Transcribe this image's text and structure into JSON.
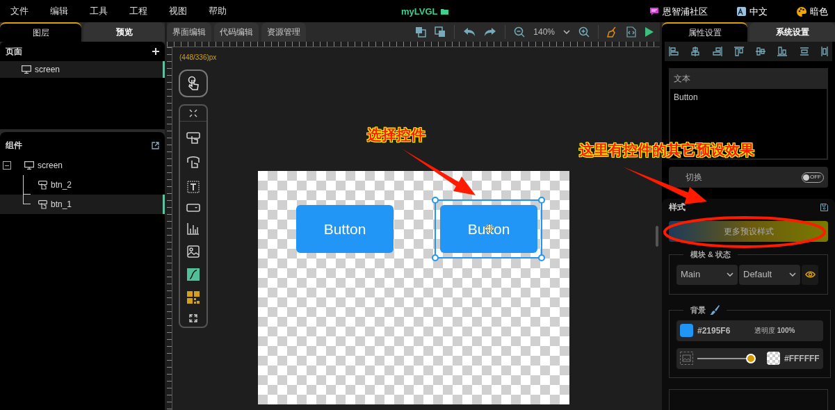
{
  "menu": [
    "文件",
    "编辑",
    "工具",
    "工程",
    "视图",
    "帮助"
  ],
  "app_title": "myLVGL",
  "top_links": [
    {
      "label": "恩智浦社区",
      "kind": "community"
    },
    {
      "label": "中文",
      "kind": "language"
    },
    {
      "label": "暗色",
      "kind": "theme"
    }
  ],
  "left_tabs": [
    {
      "label": "图层",
      "selected": true
    },
    {
      "label": "预览",
      "selected": false
    }
  ],
  "editor_tabs": [
    {
      "label": "界面编辑",
      "selected": false
    },
    {
      "label": "代码编辑",
      "selected": false
    },
    {
      "label": "资源管理",
      "selected": false
    }
  ],
  "zoom": "140%",
  "right_tabs": [
    {
      "label": "属性设置",
      "selected": true
    },
    {
      "label": "系统设置",
      "selected": false
    }
  ],
  "pages": {
    "title": "页面",
    "items": [
      {
        "label": "screen",
        "selected": true
      }
    ]
  },
  "components": {
    "title": "组件",
    "tree": [
      {
        "label": "screen",
        "kind": "screen",
        "expanded": true,
        "selected": false,
        "children": [
          {
            "label": "btn_2",
            "kind": "button",
            "selected": false
          },
          {
            "label": "btn_1",
            "kind": "button",
            "selected": true
          }
        ]
      }
    ]
  },
  "canvas": {
    "coords": "(448/336)px",
    "widgets": [
      {
        "label": "Button",
        "selected": false
      },
      {
        "label": "Button",
        "selected": true
      }
    ]
  },
  "annotations": [
    {
      "text": "选择控件"
    },
    {
      "text": "这里有控件的其它预设效果"
    }
  ],
  "properties": {
    "text_label": "文本",
    "text_value": "Button",
    "toggle": {
      "label": "切换",
      "on": false,
      "text": "OFF"
    },
    "style_title": "样式",
    "preset_button": "更多预设样式",
    "part_state": {
      "legend": "模块 & 状态",
      "part": "Main",
      "state": "Default"
    },
    "background": {
      "legend": "背景",
      "color": "#2195F6",
      "opacity": "透明度 **100%**",
      "gradient": {
        "level": 1,
        "text": "#FFFFFF"
      }
    }
  }
}
